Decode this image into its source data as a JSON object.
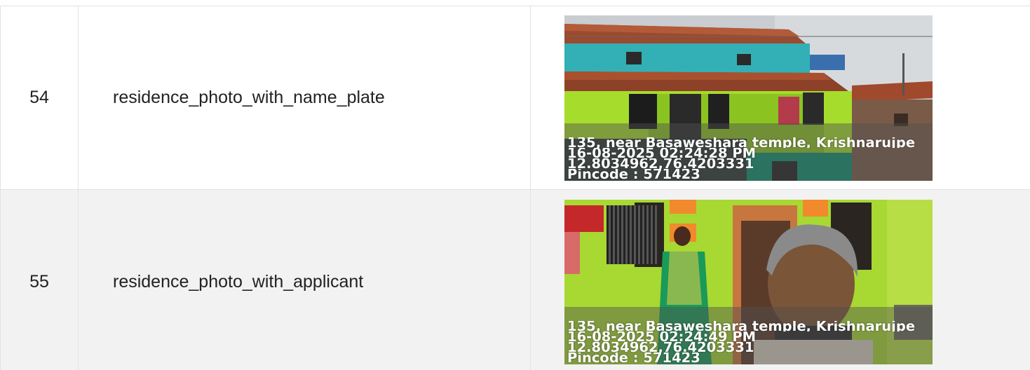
{
  "rows": [
    {
      "number": "54",
      "document": "residence_photo_with_name_plate",
      "stamp": {
        "address": "135, near Basaweshara temple, Krishnarujpe",
        "datetime": "16-08-2025 02:24:28 PM",
        "coords": "12.8034962,76.4203331",
        "pincode": "Pincode : 571423"
      }
    },
    {
      "number": "55",
      "document": "residence_photo_with_applicant",
      "stamp": {
        "address": "135, near Basaweshara temple, Krishnarujpe",
        "datetime": "16-08-2025 02:24:49 PM",
        "coords": "12.8034962,76.4203331",
        "pincode": "Pincode : 571423"
      }
    }
  ]
}
